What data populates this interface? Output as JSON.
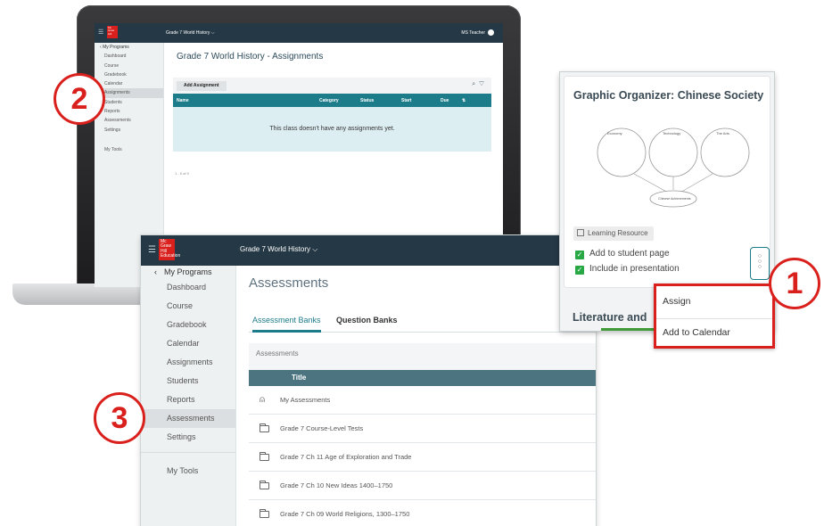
{
  "laptop_app": {
    "course_title": "Grade 7 World History",
    "user": "MS Teacher",
    "logo": "Mc Graw Hill",
    "nav": {
      "back": "My Programs",
      "items": [
        "Dashboard",
        "Course",
        "Gradebook",
        "Calendar",
        "Assignments",
        "Students",
        "Reports",
        "Assessments",
        "Settings"
      ],
      "active": "Assignments",
      "tools": "My Tools"
    },
    "page_title": "Grade 7 World History - Assignments",
    "add_button": "Add Assignment",
    "columns": [
      "Name",
      "Category",
      "Status",
      "Start",
      "Due"
    ],
    "empty_message": "This class doesn't have any assignments yet.",
    "count": "1 - 0 of 0"
  },
  "assessments_app": {
    "logo": "Mc Graw Hill Education",
    "course_title": "Grade 7 World History",
    "nav": {
      "back": "My Programs",
      "items": [
        "Dashboard",
        "Course",
        "Gradebook",
        "Calendar",
        "Assignments",
        "Students",
        "Reports",
        "Assessments",
        "Settings"
      ],
      "active": "Assessments",
      "tools": "My Tools"
    },
    "page_title": "Assessments",
    "tabs": [
      "Assessment Banks",
      "Question Banks"
    ],
    "active_tab": "Assessment Banks",
    "panel_title": "Assessments",
    "table_header": "Title",
    "rows": [
      {
        "label": "My Assessments",
        "icon": "user-icon"
      },
      {
        "label": "Grade 7 Course-Level Tests",
        "icon": "folder-icon"
      },
      {
        "label": "Grade 7 Ch 11 Age of Exploration and Trade",
        "icon": "folder-icon"
      },
      {
        "label": "Grade 7 Ch 10 New Ideas 1400–1750",
        "icon": "folder-icon"
      },
      {
        "label": "Grade 7 Ch 09 World Religions, 1300–1750",
        "icon": "folder-icon"
      }
    ]
  },
  "resource_card": {
    "title": "Graphic Organizer: Chinese Society",
    "organizer_labels": [
      "Economy",
      "Technology",
      "The Arts",
      "Chinese Achievements"
    ],
    "badge": "Learning Resource",
    "checks": [
      "Add to student page",
      "Include in presentation"
    ],
    "next_title": "Literature and",
    "menu": [
      "Assign",
      "Add to Calendar"
    ]
  },
  "steps": [
    "1",
    "2",
    "3"
  ],
  "colors": {
    "brand_red": "#d9201c",
    "teal": "#1c7c8a",
    "topbar": "#253845",
    "check_green": "#27a844"
  }
}
